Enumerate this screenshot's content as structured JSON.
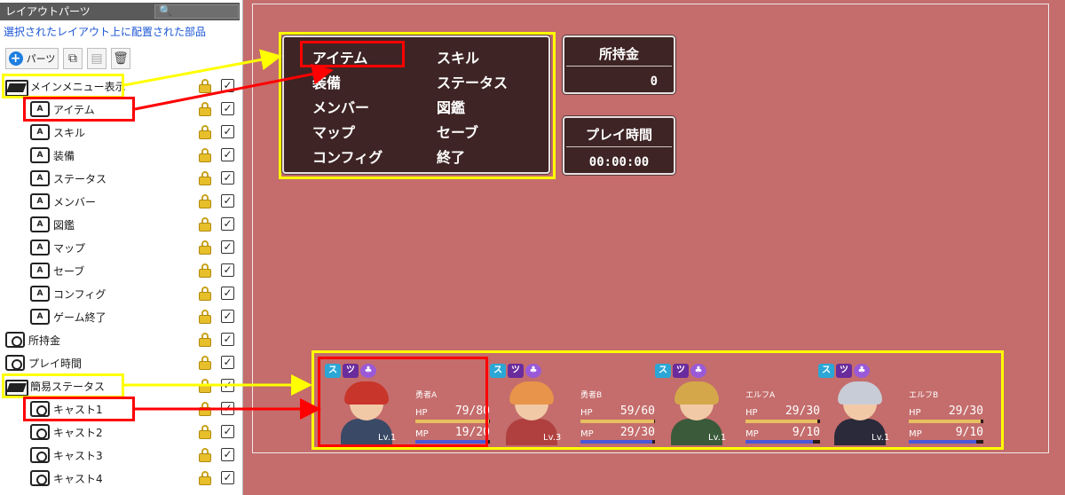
{
  "panel": {
    "title": "レイアウトパーツ",
    "search_icon": "search-icon",
    "description": "選択されたレイアウト上に配置された部品",
    "toolbar": {
      "parts_label": "パーツ"
    }
  },
  "tree": [
    {
      "label": "メインメニュー表示",
      "type": "folder",
      "indent": 0
    },
    {
      "label": "アイテム",
      "type": "item",
      "indent": 1
    },
    {
      "label": "スキル",
      "type": "item",
      "indent": 1
    },
    {
      "label": "装備",
      "type": "item",
      "indent": 1
    },
    {
      "label": "ステータス",
      "type": "item",
      "indent": 1
    },
    {
      "label": "メンバー",
      "type": "item",
      "indent": 1
    },
    {
      "label": "図鑑",
      "type": "item",
      "indent": 1
    },
    {
      "label": "マップ",
      "type": "item",
      "indent": 1
    },
    {
      "label": "セーブ",
      "type": "item",
      "indent": 1
    },
    {
      "label": "コンフィグ",
      "type": "item",
      "indent": 1
    },
    {
      "label": "ゲーム終了",
      "type": "item",
      "indent": 1
    },
    {
      "label": "所持金",
      "type": "cast",
      "indent": 0
    },
    {
      "label": "プレイ時間",
      "type": "cast",
      "indent": 0
    },
    {
      "label": "簡易ステータス",
      "type": "folder",
      "indent": 0
    },
    {
      "label": "キャスト1",
      "type": "cast",
      "indent": 1
    },
    {
      "label": "キャスト2",
      "type": "cast",
      "indent": 1
    },
    {
      "label": "キャスト3",
      "type": "cast",
      "indent": 1
    },
    {
      "label": "キャスト4",
      "type": "cast",
      "indent": 1
    }
  ],
  "menu": {
    "left": [
      "アイテム",
      "装備",
      "メンバー",
      "マップ",
      "コンフィグ"
    ],
    "right": [
      "スキル",
      "ステータス",
      "図鑑",
      "セーブ",
      "終了"
    ]
  },
  "gold": {
    "title": "所持金",
    "value": "0"
  },
  "playtime": {
    "title": "プレイ時間",
    "value": "00:00:00"
  },
  "casts": [
    {
      "name": "勇者A",
      "hp_label": "HP",
      "hp": "79/80",
      "hp_frac": 0.9875,
      "mp_label": "MP",
      "mp": "19/20",
      "mp_frac": 0.95,
      "lv": "Lv.1",
      "hair": "#c8352a",
      "body": "#3a4a66"
    },
    {
      "name": "勇者B",
      "hp_label": "HP",
      "hp": "59/60",
      "hp_frac": 0.983,
      "mp_label": "MP",
      "mp": "29/30",
      "mp_frac": 0.967,
      "lv": "Lv.3",
      "hair": "#e8944a",
      "body": "#b04040"
    },
    {
      "name": "エルフA",
      "hp_label": "HP",
      "hp": "29/30",
      "hp_frac": 0.967,
      "mp_label": "MP",
      "mp": "9/10",
      "mp_frac": 0.9,
      "lv": "Lv.1",
      "hair": "#d4a84a",
      "body": "#3a5a3a"
    },
    {
      "name": "エルフB",
      "hp_label": "HP",
      "hp": "29/30",
      "hp_frac": 0.967,
      "mp_label": "MP",
      "mp": "9/10",
      "mp_frac": 0.9,
      "lv": "Lv.1",
      "hair": "#c8ccd6",
      "body": "#2a2a3a"
    }
  ],
  "state_icon_labels": [
    "ス",
    "ツ",
    "♣"
  ],
  "colors": {
    "highlight_yellow": "#ffff00",
    "highlight_red": "#ff0000",
    "hp_gauge": "#e8c060",
    "mp_gauge": "#4a58d8"
  }
}
